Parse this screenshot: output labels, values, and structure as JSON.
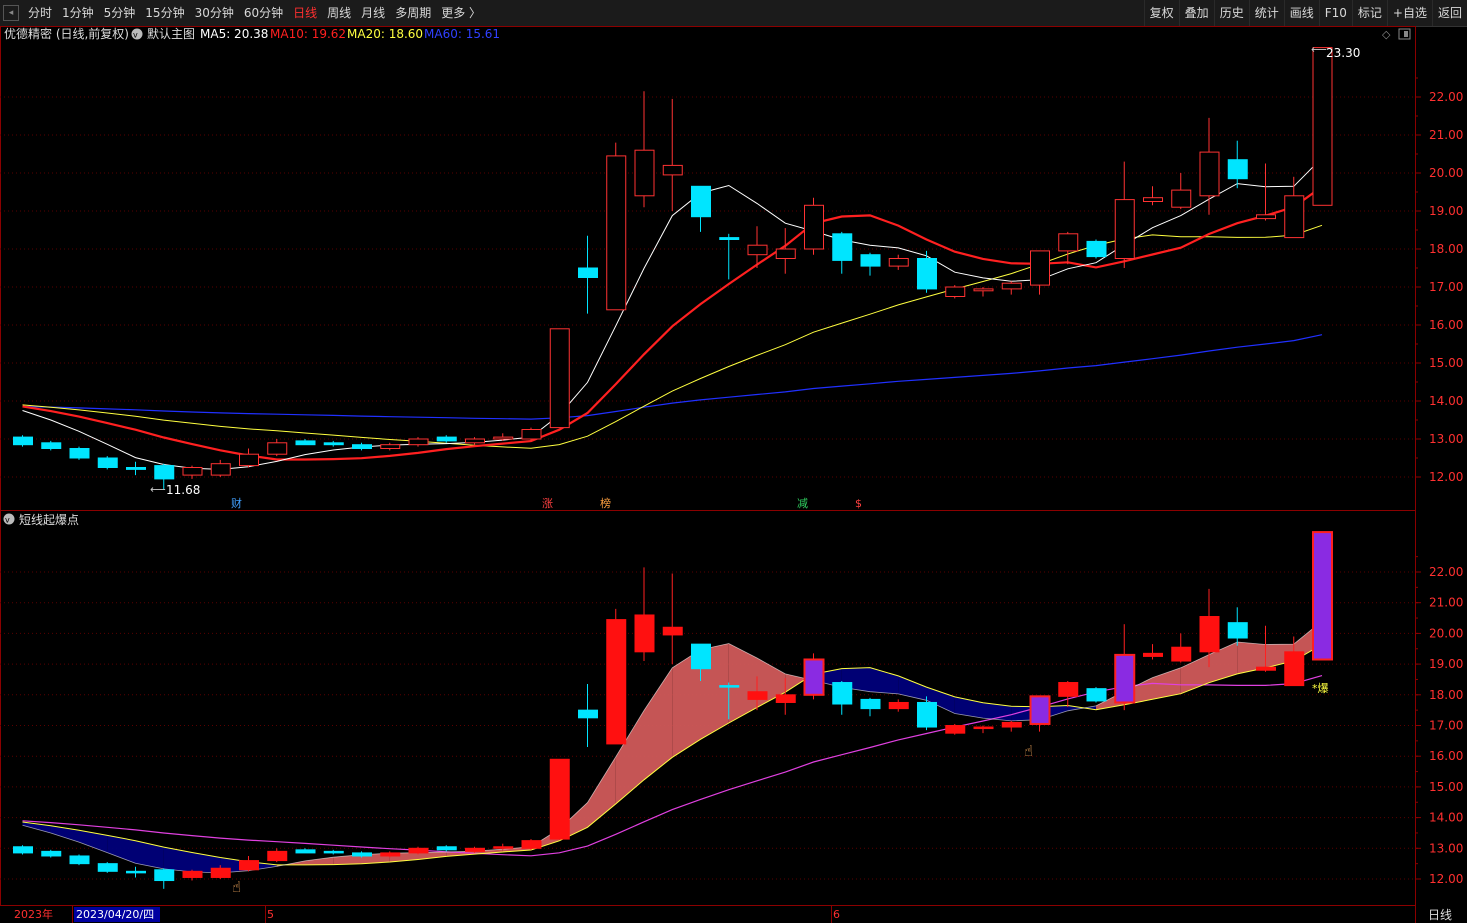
{
  "toolbar": {
    "left": [
      "分时",
      "1分钟",
      "5分钟",
      "15分钟",
      "30分钟",
      "60分钟",
      "日线",
      "周线",
      "月线",
      "多周期",
      "更多 〉"
    ],
    "active_index": 6,
    "right": [
      "复权",
      "叠加",
      "历史",
      "统计",
      "画线",
      "F10",
      "标记",
      "+自选",
      "返回"
    ]
  },
  "main_panel": {
    "stock_title": "优德精密 (日线,前复权)",
    "template_label": "默认主图",
    "ma5": "MA5: 20.38",
    "ma10": "MA10: 19.62",
    "ma20": "MA20: 18.60",
    "ma60": "MA60: 15.61",
    "high_marker": "23.30",
    "low_marker": "11.68",
    "event_labels": [
      "财",
      "涨",
      "榜",
      "减",
      "$"
    ]
  },
  "sub_panel": {
    "indicator_name": "短线起爆点",
    "signal_text": "*爆"
  },
  "price_axis": {
    "main": [
      "22.00",
      "21.00",
      "20.00",
      "19.00",
      "18.00",
      "17.00",
      "16.00",
      "15.00",
      "14.00",
      "13.00",
      "12.00"
    ],
    "sub": [
      "22.00",
      "21.00",
      "20.00",
      "19.00",
      "18.00",
      "17.00",
      "16.00",
      "15.00",
      "14.00",
      "13.00",
      "12.00"
    ]
  },
  "date_axis": {
    "year": "2023年",
    "cursor_date": "2023/04/20/四",
    "month_5": "5",
    "month_6": "6",
    "period_label": "日线"
  },
  "colors": {
    "up": "#ff3232",
    "down": "#00e5ff",
    "ma5": "#ffffff",
    "ma10": "#ff2020",
    "ma20": "#ffff40",
    "ma60": "#2030ff",
    "band_up": "#d05a5a",
    "band_down": "#00007a",
    "purple_candle": "#8a2be2",
    "magenta_line": "#e040e0"
  },
  "chart_data": {
    "type": "candlestick",
    "symbol": "优德精密",
    "period": "日线",
    "ylim": [
      11.5,
      23.5
    ],
    "candles": [
      {
        "o": 13.05,
        "h": 13.1,
        "l": 12.8,
        "c": 12.85
      },
      {
        "o": 12.9,
        "h": 12.95,
        "l": 12.7,
        "c": 12.75
      },
      {
        "o": 12.75,
        "h": 12.8,
        "l": 12.45,
        "c": 12.5
      },
      {
        "o": 12.5,
        "h": 12.55,
        "l": 12.2,
        "c": 12.25
      },
      {
        "o": 12.25,
        "h": 12.4,
        "l": 12.05,
        "c": 12.2
      },
      {
        "o": 12.3,
        "h": 12.35,
        "l": 11.68,
        "c": 11.95
      },
      {
        "o": 12.05,
        "h": 12.3,
        "l": 11.95,
        "c": 12.25
      },
      {
        "o": 12.05,
        "h": 12.45,
        "l": 12.0,
        "c": 12.35
      },
      {
        "o": 12.3,
        "h": 12.75,
        "l": 12.25,
        "c": 12.6
      },
      {
        "o": 12.6,
        "h": 13.0,
        "l": 12.55,
        "c": 12.9
      },
      {
        "o": 12.95,
        "h": 13.0,
        "l": 12.85,
        "c": 12.85
      },
      {
        "o": 12.9,
        "h": 12.95,
        "l": 12.8,
        "c": 12.85
      },
      {
        "o": 12.85,
        "h": 12.9,
        "l": 12.7,
        "c": 12.75
      },
      {
        "o": 12.75,
        "h": 12.9,
        "l": 12.7,
        "c": 12.85
      },
      {
        "o": 12.85,
        "h": 13.05,
        "l": 12.8,
        "c": 13.0
      },
      {
        "o": 13.05,
        "h": 13.1,
        "l": 12.9,
        "c": 12.95
      },
      {
        "o": 12.9,
        "h": 13.05,
        "l": 12.85,
        "c": 13.0
      },
      {
        "o": 13.0,
        "h": 13.15,
        "l": 12.95,
        "c": 13.05
      },
      {
        "o": 13.0,
        "h": 13.3,
        "l": 12.95,
        "c": 13.25
      },
      {
        "o": 13.3,
        "h": 15.9,
        "l": 13.3,
        "c": 15.9
      },
      {
        "o": 17.5,
        "h": 18.35,
        "l": 16.3,
        "c": 17.25
      },
      {
        "o": 16.4,
        "h": 20.8,
        "l": 16.4,
        "c": 20.45
      },
      {
        "o": 19.4,
        "h": 22.15,
        "l": 19.1,
        "c": 20.6
      },
      {
        "o": 19.95,
        "h": 21.95,
        "l": 19.0,
        "c": 20.2
      },
      {
        "o": 19.65,
        "h": 19.65,
        "l": 18.45,
        "c": 18.85
      },
      {
        "o": 18.3,
        "h": 18.4,
        "l": 17.2,
        "c": 18.25
      },
      {
        "o": 17.85,
        "h": 18.6,
        "l": 17.5,
        "c": 18.1
      },
      {
        "o": 17.75,
        "h": 18.55,
        "l": 17.35,
        "c": 18.0
      },
      {
        "o": 18.0,
        "h": 19.35,
        "l": 17.85,
        "c": 19.15
      },
      {
        "o": 18.4,
        "h": 18.45,
        "l": 17.35,
        "c": 17.7
      },
      {
        "o": 17.85,
        "h": 17.9,
        "l": 17.3,
        "c": 17.55
      },
      {
        "o": 17.55,
        "h": 17.85,
        "l": 17.45,
        "c": 17.75
      },
      {
        "o": 17.75,
        "h": 17.95,
        "l": 16.85,
        "c": 16.95
      },
      {
        "o": 16.75,
        "h": 17.05,
        "l": 16.7,
        "c": 17.0
      },
      {
        "o": 16.9,
        "h": 17.0,
        "l": 16.75,
        "c": 16.95
      },
      {
        "o": 16.95,
        "h": 17.15,
        "l": 16.8,
        "c": 17.1
      },
      {
        "o": 17.05,
        "h": 17.95,
        "l": 16.8,
        "c": 17.95
      },
      {
        "o": 17.95,
        "h": 18.45,
        "l": 17.6,
        "c": 18.4
      },
      {
        "o": 18.2,
        "h": 18.25,
        "l": 17.75,
        "c": 17.8
      },
      {
        "o": 17.75,
        "h": 20.3,
        "l": 17.5,
        "c": 19.3
      },
      {
        "o": 19.25,
        "h": 19.65,
        "l": 19.15,
        "c": 19.35
      },
      {
        "o": 19.1,
        "h": 20.0,
        "l": 19.05,
        "c": 19.55
      },
      {
        "o": 19.4,
        "h": 21.45,
        "l": 18.9,
        "c": 20.55
      },
      {
        "o": 20.35,
        "h": 20.85,
        "l": 19.6,
        "c": 19.85
      },
      {
        "o": 18.8,
        "h": 20.25,
        "l": 18.75,
        "c": 18.9
      },
      {
        "o": 18.3,
        "h": 19.9,
        "l": 18.3,
        "c": 19.4
      },
      {
        "o": 19.15,
        "h": 23.3,
        "l": 19.15,
        "c": 23.3
      }
    ]
  }
}
